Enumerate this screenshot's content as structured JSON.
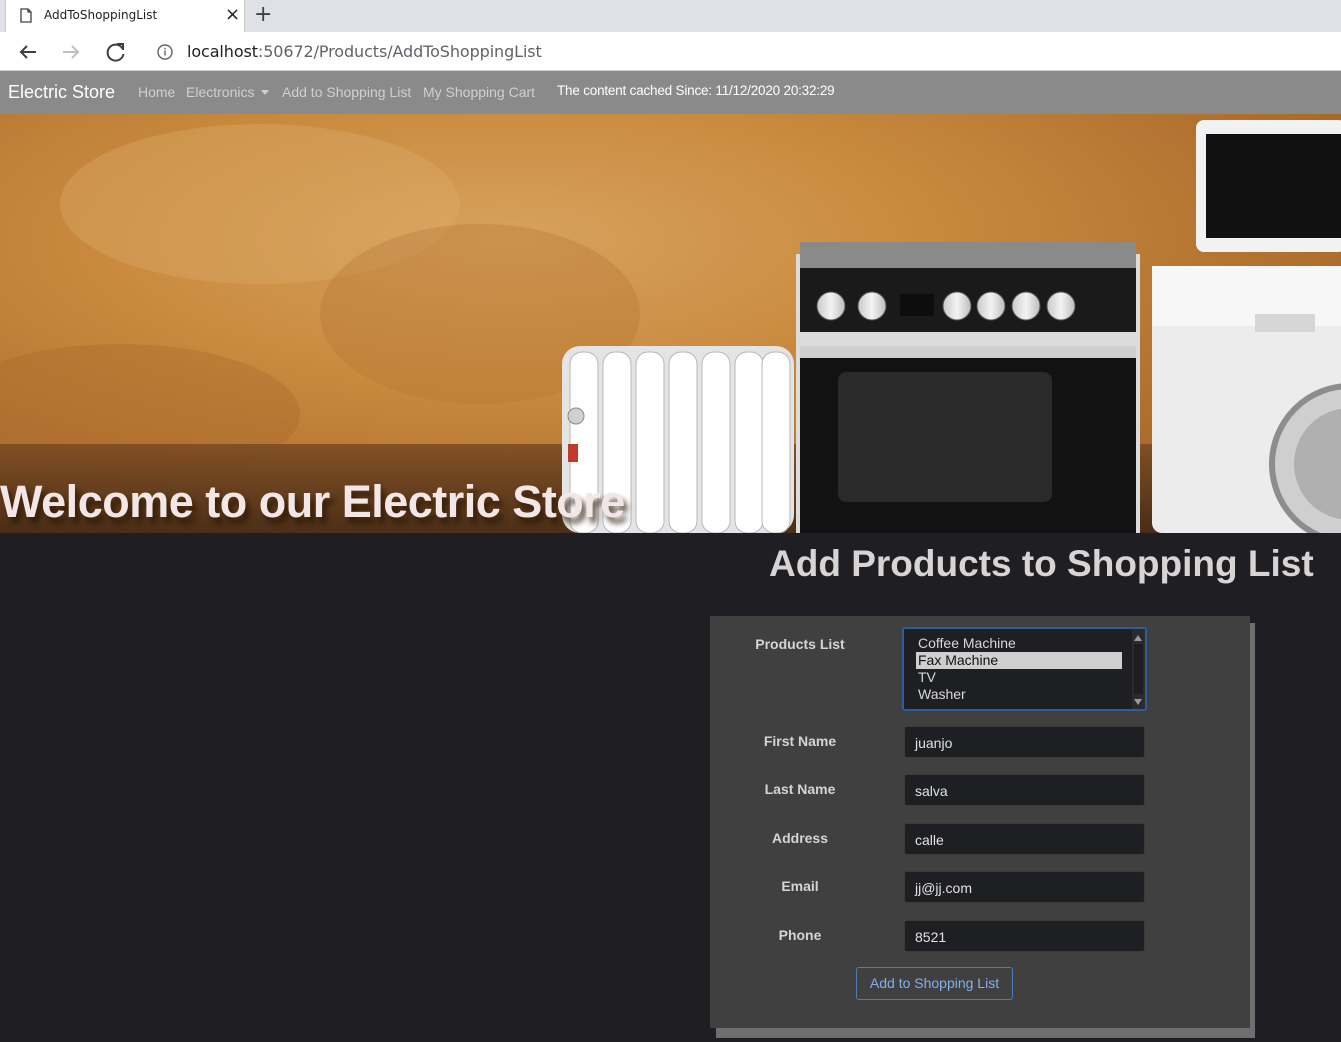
{
  "browser": {
    "tab_title": "AddToShoppingList",
    "tab_close": "×",
    "new_tab": "+",
    "url_host": "localhost",
    "url_path": ":50672/Products/AddToShoppingList"
  },
  "navbar": {
    "brand": "Electric Store",
    "items": [
      {
        "label": "Home"
      },
      {
        "label": "Electronics"
      },
      {
        "label": "Add to Shopping List"
      },
      {
        "label": "My Shopping Cart"
      }
    ],
    "cached_text": "The content cached Since: 11/12/2020 20:32:29"
  },
  "hero": {
    "title": "Welcome to our Electric Store"
  },
  "main": {
    "title": "Add Products to Shopping List"
  },
  "form": {
    "products_label": "Products List",
    "products": [
      {
        "label": "Coffee Machine",
        "selected": false
      },
      {
        "label": "Fax Machine",
        "selected": true
      },
      {
        "label": "TV",
        "selected": false
      },
      {
        "label": "Washer",
        "selected": false
      }
    ],
    "first_name_label": "First Name",
    "first_name_value": "juanjo",
    "last_name_label": "Last Name",
    "last_name_value": "salva",
    "address_label": "Address",
    "address_value": "calle",
    "email_label": "Email",
    "email_value": "jj@jj.com",
    "phone_label": "Phone",
    "phone_value": "8521",
    "submit_label": "Add to Shopping List"
  },
  "colors": {
    "page_bg": "#1f1f23",
    "navbar_bg": "#8a8a8a",
    "card_bg": "#404040",
    "accent": "#4a7cc0"
  }
}
